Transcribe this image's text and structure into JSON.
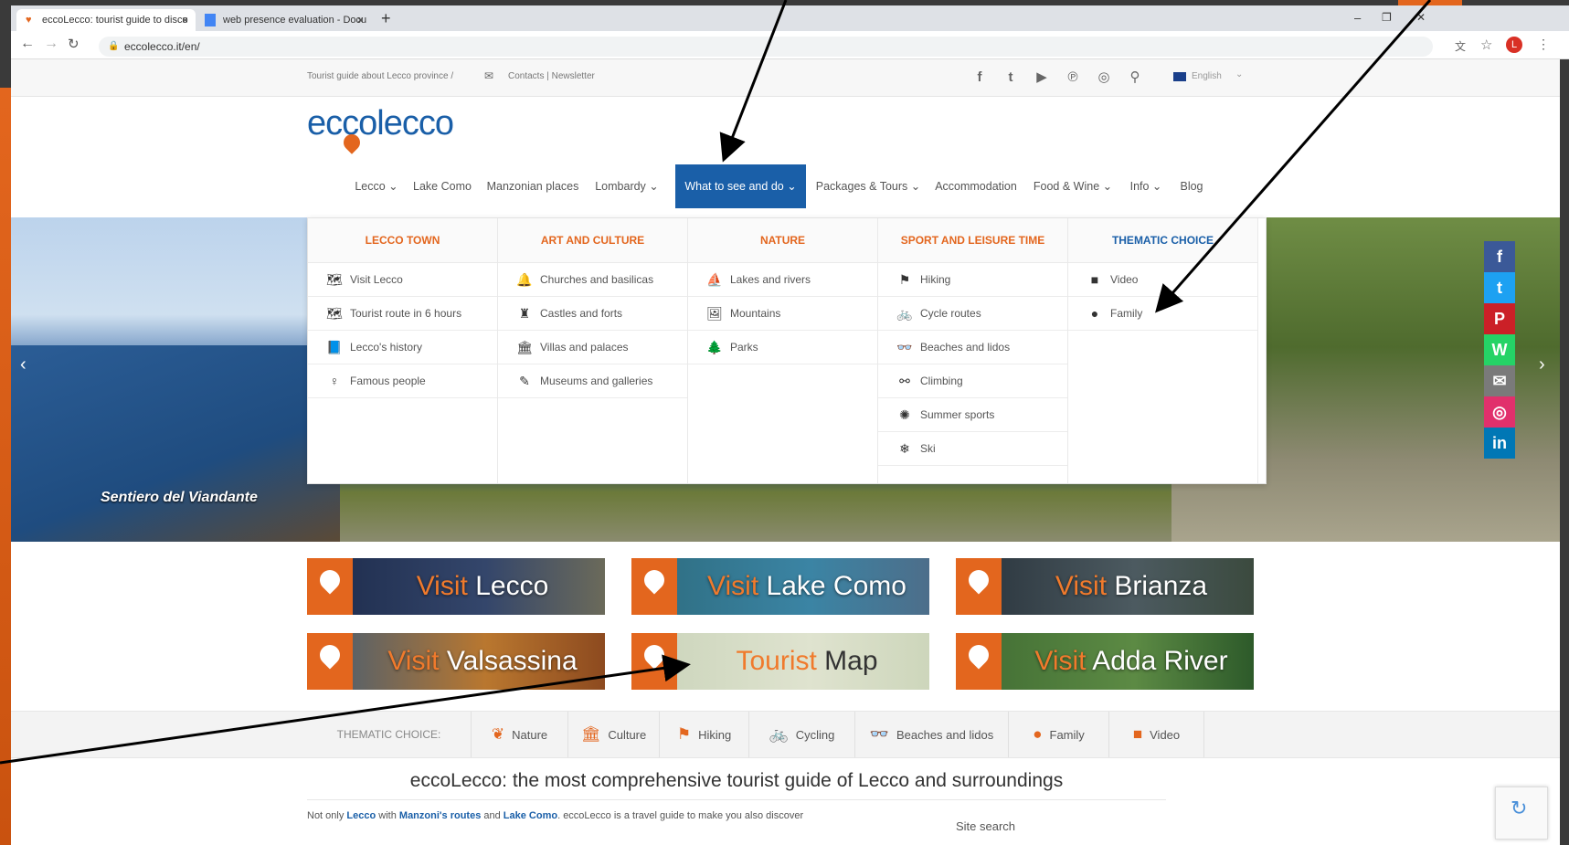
{
  "browser": {
    "tabs": [
      {
        "title": "eccoLecco: tourist guide to disco",
        "close": "×"
      },
      {
        "title": "web presence evaluation - Docu",
        "close": "×"
      }
    ],
    "new_tab": "+",
    "url": "eccolecco.it/en/",
    "profile_initial": "L",
    "window_controls": [
      "–",
      "❐",
      "✕"
    ]
  },
  "top_strip": {
    "tagline": "Tourist guide about Lecco province  /",
    "contacts": "Contacts | Newsletter",
    "language": "English"
  },
  "logo": {
    "text": "eccolecco"
  },
  "nav": [
    {
      "label": "Lecco",
      "caret": true
    },
    {
      "label": "Lake Como",
      "caret": false
    },
    {
      "label": "Manzonian places",
      "caret": false
    },
    {
      "label": "Lombardy",
      "caret": true
    },
    {
      "label": "What to see and do",
      "caret": true,
      "active": true
    },
    {
      "label": "Packages & Tours",
      "caret": true
    },
    {
      "label": "Accommodation",
      "caret": false
    },
    {
      "label": "Food & Wine",
      "caret": true
    },
    {
      "label": "Info",
      "caret": true
    },
    {
      "label": "Blog",
      "caret": false
    }
  ],
  "mega_menu": [
    {
      "heading": "LECCO TOWN",
      "items": [
        {
          "icon": "map-icon",
          "glyph": "🗺",
          "label": "Visit Lecco"
        },
        {
          "icon": "map-icon",
          "glyph": "🗺",
          "label": "Tourist route in 6 hours"
        },
        {
          "icon": "book-icon",
          "glyph": "📘",
          "label": "Lecco's history"
        },
        {
          "icon": "person-icon",
          "glyph": "♀",
          "label": "Famous people"
        }
      ]
    },
    {
      "heading": "ART AND CULTURE",
      "items": [
        {
          "icon": "bell-icon",
          "glyph": "🔔",
          "label": "Churches and basilicas"
        },
        {
          "icon": "castle-icon",
          "glyph": "♜",
          "label": "Castles and forts"
        },
        {
          "icon": "columns-icon",
          "glyph": "🏛",
          "label": "Villas and palaces"
        },
        {
          "icon": "paint-icon",
          "glyph": "✎",
          "label": "Museums and galleries"
        }
      ]
    },
    {
      "heading": "NATURE",
      "items": [
        {
          "icon": "ship-icon",
          "glyph": "⛵",
          "label": "Lakes and rivers"
        },
        {
          "icon": "picture-icon",
          "glyph": "🖼",
          "label": "Mountains"
        },
        {
          "icon": "tree-icon",
          "glyph": "🌲",
          "label": "Parks"
        }
      ]
    },
    {
      "heading": "SPORT AND LEISURE TIME",
      "items": [
        {
          "icon": "signpost-icon",
          "glyph": "⚑",
          "label": "Hiking"
        },
        {
          "icon": "bicycle-icon",
          "glyph": "🚲",
          "label": "Cycle routes"
        },
        {
          "icon": "sunglasses-icon",
          "glyph": "👓",
          "label": "Beaches and lidos"
        },
        {
          "icon": "carabiner-icon",
          "glyph": "⚯",
          "label": "Climbing"
        },
        {
          "icon": "sun-icon",
          "glyph": "✺",
          "label": "Summer sports"
        },
        {
          "icon": "snowflake-icon",
          "glyph": "❄",
          "label": "Ski"
        }
      ]
    },
    {
      "heading": "THEMATIC CHOICE",
      "items": [
        {
          "icon": "video-icon",
          "glyph": "■",
          "label": "Video"
        },
        {
          "icon": "balloon-icon",
          "glyph": "●",
          "label": "Family"
        }
      ]
    }
  ],
  "hero": {
    "caption": "Sentiero del Viandante"
  },
  "banners": [
    {
      "visit": "Visit",
      "place": "Lecco"
    },
    {
      "visit": "Visit",
      "place": "Lake Como"
    },
    {
      "visit": "Visit",
      "place": "Brianza"
    },
    {
      "visit": "Visit",
      "place": "Valsassina"
    },
    {
      "visit": "Tourist",
      "place": "Map"
    },
    {
      "visit": "Visit",
      "place": "Adda River"
    }
  ],
  "thematic": {
    "label": "THEMATIC CHOICE:",
    "items": [
      {
        "icon": "leaf-icon",
        "glyph": "❦",
        "label": "Nature"
      },
      {
        "icon": "columns-icon",
        "glyph": "🏛",
        "label": "Culture"
      },
      {
        "icon": "signpost-icon",
        "glyph": "⚑",
        "label": "Hiking"
      },
      {
        "icon": "bicycle-icon",
        "glyph": "🚲",
        "label": "Cycling"
      },
      {
        "icon": "sunglasses-icon",
        "glyph": "👓",
        "label": "Beaches and lidos"
      },
      {
        "icon": "balloon-icon",
        "glyph": "●",
        "label": "Family"
      },
      {
        "icon": "video-icon",
        "glyph": "■",
        "label": "Video"
      }
    ]
  },
  "intro": {
    "heading": "eccoLecco: the most comprehensive tourist guide of Lecco and surroundings",
    "text_prefix": "Not only ",
    "link1": "Lecco",
    "text_mid1": " with ",
    "link2": "Manzoni's routes",
    "text_mid2": " and ",
    "link3": "Lake Como",
    "text_suffix": ". eccoLecco is a travel guide to make you also discover",
    "sidebar_search": "Site search"
  },
  "share": [
    "f",
    "t",
    "P",
    "W",
    "✉",
    "◎",
    "in"
  ],
  "colors": {
    "accent": "#e3661e",
    "brand_blue": "#1a5fa8"
  }
}
